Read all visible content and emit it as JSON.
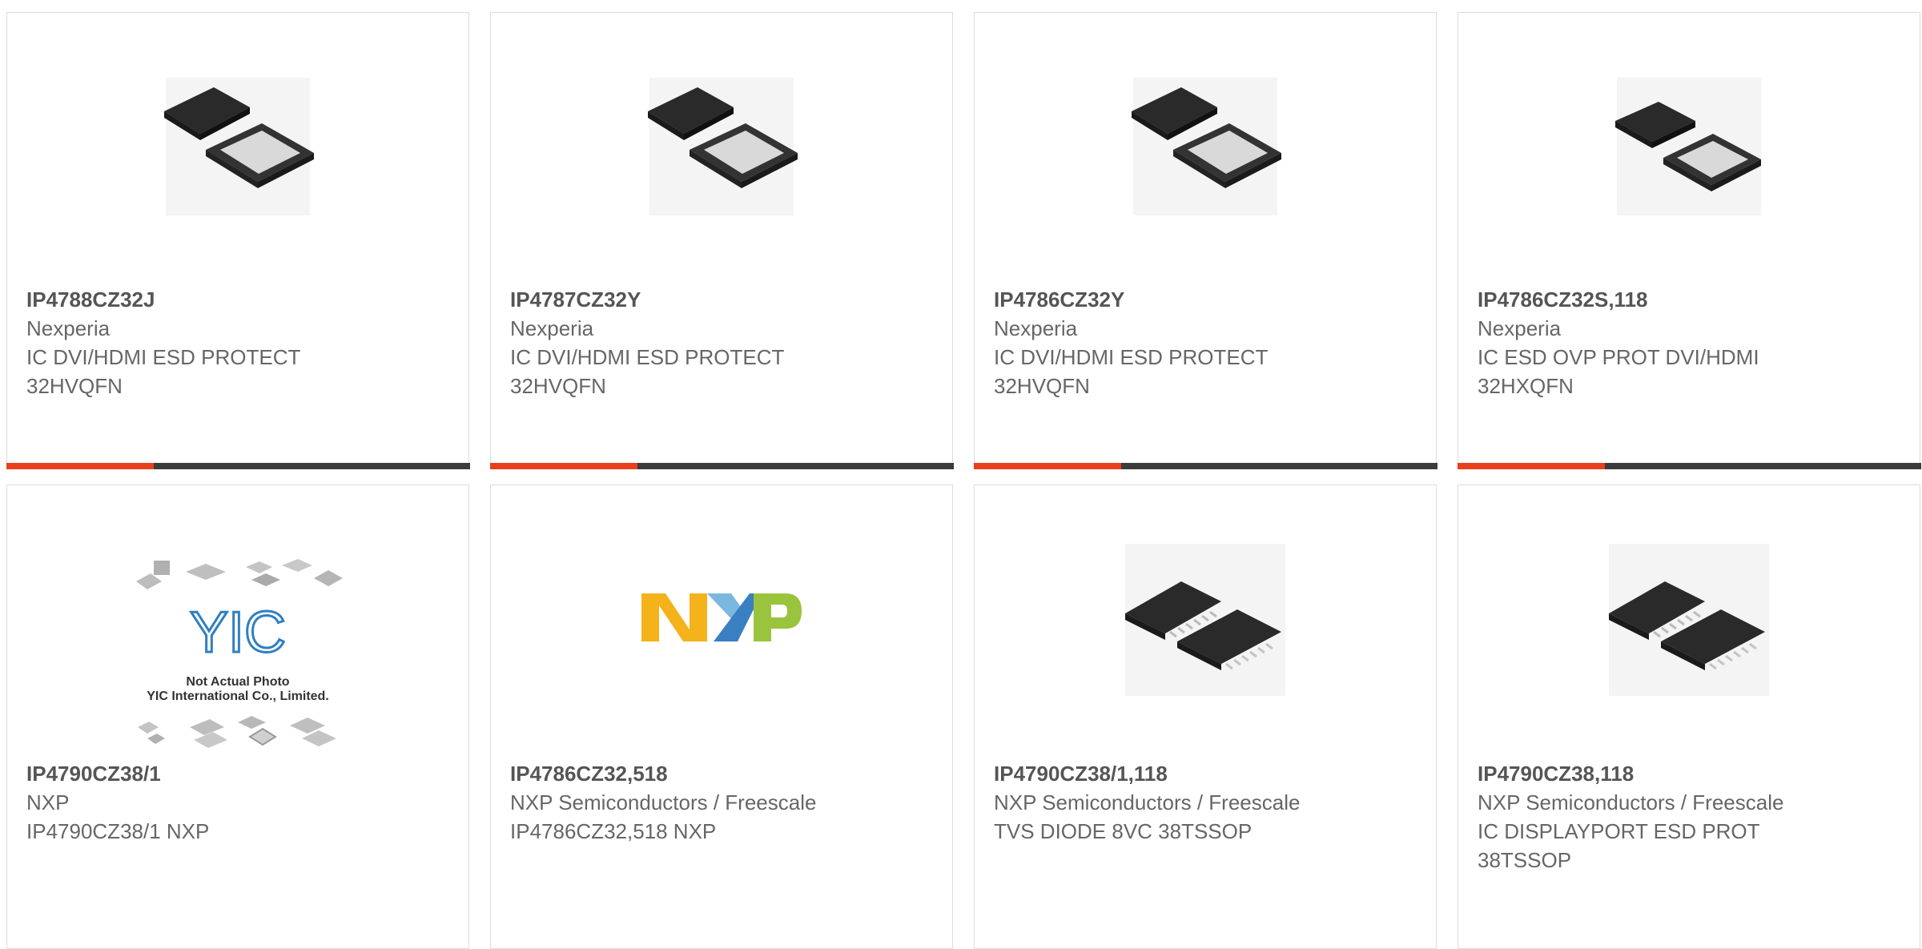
{
  "colors": {
    "accent": "#e8401c",
    "bar": "#3b3b3b",
    "border": "#dcdcdc",
    "part_text": "#555555",
    "body_text": "#666666"
  },
  "products": [
    {
      "part_number": "IP4788CZ32J",
      "manufacturer": "Nexperia",
      "description": "IC DVI/HDMI ESD PROTECT 32HVQFN",
      "image": "qfn-chip-icon"
    },
    {
      "part_number": "IP4787CZ32Y",
      "manufacturer": "Nexperia",
      "description": "IC DVI/HDMI ESD PROTECT 32HVQFN",
      "image": "qfn-chip-icon"
    },
    {
      "part_number": "IP4786CZ32Y",
      "manufacturer": "Nexperia",
      "description": "IC DVI/HDMI ESD PROTECT 32HVQFN",
      "image": "qfn-chip-icon"
    },
    {
      "part_number": "IP4786CZ32S,118",
      "manufacturer": "Nexperia",
      "description": "IC ESD OVP PROT DVI/HDMI 32HXQFN",
      "image": "qfn-chip-icon"
    },
    {
      "part_number": "IP4790CZ38/1",
      "manufacturer": "NXP",
      "description": "IP4790CZ38/1 NXP",
      "image": "placeholder-photo-icon",
      "image_text": {
        "logo": "YIC",
        "line1": "Not Actual Photo",
        "line2": "YIC International Co., Limited."
      }
    },
    {
      "part_number": "IP4786CZ32,518",
      "manufacturer": "NXP Semiconductors / Freescale",
      "description": "IP4786CZ32,518 NXP",
      "image": "nxp-logo",
      "image_text": {
        "logo": "NXP"
      }
    },
    {
      "part_number": "IP4790CZ38/1,118",
      "manufacturer": "NXP Semiconductors / Freescale",
      "description": "TVS DIODE 8VC 38TSSOP",
      "image": "tssop-chip-icon"
    },
    {
      "part_number": "IP4790CZ38,118",
      "manufacturer": "NXP Semiconductors / Freescale",
      "description": "IC DISPLAYPORT ESD PROT 38TSSOP",
      "image": "tssop-chip-icon"
    }
  ]
}
